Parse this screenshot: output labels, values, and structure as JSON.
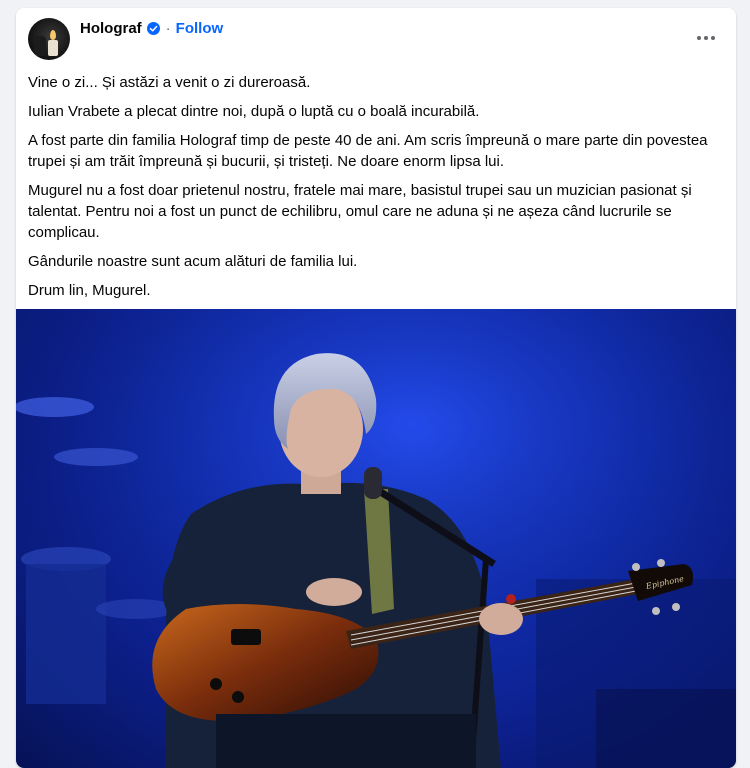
{
  "post": {
    "page_name": "Holograf",
    "follow_label": "Follow",
    "separator": "·",
    "paragraphs": [
      "Vine o zi... Și astăzi a venit o zi dureroasă.",
      "Iulian Vrabete a plecat dintre noi, după o luptă cu o boală incurabilă.",
      "A fost parte din familia Holograf timp de peste 40 de ani. Am scris împreună o mare parte din povestea trupei și am trăit împreună și bucurii, și tristeți. Ne doare enorm lipsa lui.",
      "Mugurel nu a fost doar prietenul nostru, fratele mai mare, basistul trupei sau un muzician pasionat și talentat. Pentru noi a fost un punct de echilibru, omul care ne aduna și ne așeza când lucrurile se complicau.",
      "Gândurile noastre sunt acum alături de familia lui.",
      "Drum lin, Mugurel."
    ],
    "photo_logo_text": "Epiphone"
  },
  "icons": {
    "verified": "verified-badge-icon",
    "more": "more-options-icon"
  },
  "colors": {
    "link_blue": "#0866ff",
    "verified_blue": "#0866ff",
    "stage_blue": "#1b3fd6",
    "text": "#050505",
    "secondary_text": "#65676b"
  }
}
